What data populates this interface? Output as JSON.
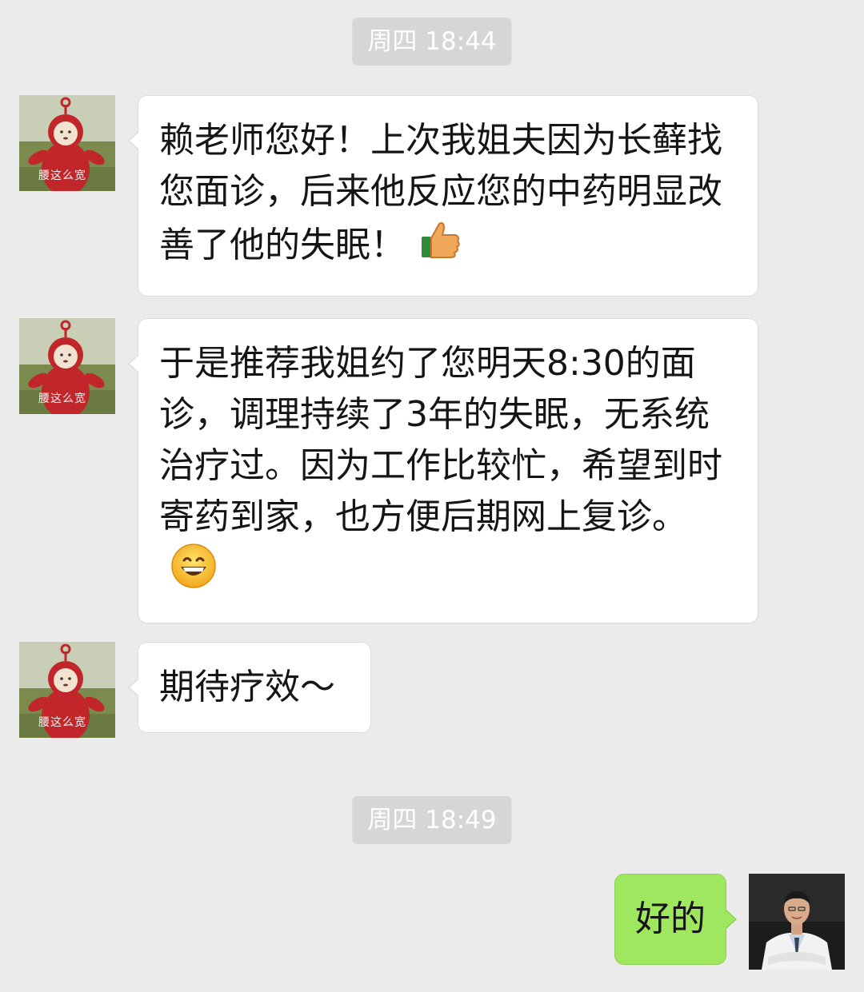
{
  "timestamps": [
    "周四 18:44",
    "周四 18:49"
  ],
  "contact": {
    "avatar_caption": "腰这么宽",
    "avatar_icon": "teletubby-avatar-icon"
  },
  "self": {
    "avatar_icon": "doctor-avatar-icon"
  },
  "messages": [
    {
      "from": "contact",
      "text": "赖老师您好！上次我姐夫因为长藓找您面诊，后来他反应您的中药明显改善了他的失眠！",
      "emoji": "thumbs-up-icon"
    },
    {
      "from": "contact",
      "text": "于是推荐我姐约了您明天8:30的面诊，调理持续了3年的失眠，无系统治疗过。因为工作比较忙，希望到时寄药到家，也方便后期网上复诊。",
      "emoji": "grinning-face-icon"
    },
    {
      "from": "contact",
      "text": "期待疗效～"
    },
    {
      "from": "self",
      "text": "好的"
    }
  ],
  "colors": {
    "background": "#ebebeb",
    "incoming_bubble": "#ffffff",
    "outgoing_bubble": "#9fe75f",
    "timestamp_chip": "#d6d6d6"
  }
}
